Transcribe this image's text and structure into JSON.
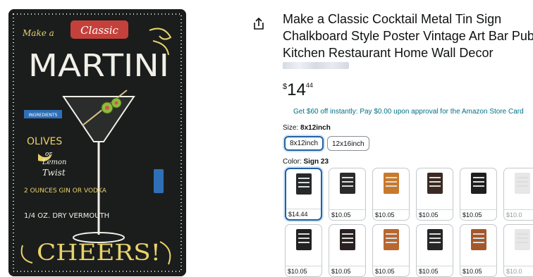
{
  "image": {
    "sign_words": {
      "make_a": "Make a",
      "classic": "Classic",
      "martini": "MARTINI",
      "ingredients": "INGREDIENTS",
      "olives": "OLIVES",
      "or": "or",
      "lemon": "Lemon",
      "twist": "Twist",
      "two_ounces_gin": "2 OUNCES GIN OR VODKA",
      "dry_vermouth": "1/4 OZ. DRY VERMOUTH",
      "cheers": "CHEERS!"
    },
    "colors": {
      "board": "#1b1d1c",
      "chalk": "#f1efe8",
      "accent_red": "#d9534f",
      "accent_yellow": "#e8d36a",
      "olive": "#8dbb3d"
    }
  },
  "product": {
    "title_lines": [
      "Make a Classic Cocktail Metal Tin Sign",
      "Chalkboard Style Poster Vintage Art Bar Pub",
      "Kitchen Restaurant Home Wall Decor"
    ],
    "price": {
      "symbol": "$",
      "whole": "14",
      "fraction": "44"
    },
    "promo": "Get $60 off instantly: Pay $0.00 upon approval for the Amazon Store Card"
  },
  "size": {
    "label": "Size:",
    "selected": "8x12inch",
    "options": [
      "8x12inch",
      "12x16inch"
    ]
  },
  "color": {
    "label": "Color:",
    "selected": "Sign 23",
    "swatches": [
      {
        "price": "$14.44",
        "thumb": "#26292a"
      },
      {
        "price": "$10.05",
        "thumb": "#2b2b2b"
      },
      {
        "price": "$10.05",
        "thumb": "#c8792c"
      },
      {
        "price": "$10.05",
        "thumb": "#3a2a22"
      },
      {
        "price": "$10.05",
        "thumb": "#1f1f1f"
      },
      {
        "price": "$10.0",
        "thumb": "#e7e7e7"
      },
      {
        "price": "$10.05",
        "thumb": "#222222"
      },
      {
        "price": "$10.05",
        "thumb": "#2a2222"
      },
      {
        "price": "$10.05",
        "thumb": "#b9672f"
      },
      {
        "price": "$10.05",
        "thumb": "#262626"
      },
      {
        "price": "$10.05",
        "thumb": "#a4582a"
      },
      {
        "price": "$10.0",
        "thumb": "#e7e7e7"
      }
    ]
  },
  "icons": {
    "share": "share-icon"
  }
}
